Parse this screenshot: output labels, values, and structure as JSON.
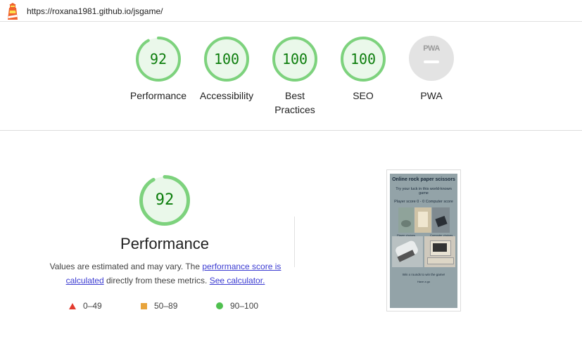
{
  "header": {
    "url": "https://roxana1981.github.io/jsgame/"
  },
  "categories": [
    {
      "score": "92",
      "label": "Performance",
      "fraction": 0.92
    },
    {
      "score": "100",
      "label": "Accessibility",
      "fraction": 1.0
    },
    {
      "score": "100",
      "label": "Best Practices",
      "fraction": 1.0
    },
    {
      "score": "100",
      "label": "SEO",
      "fraction": 1.0
    }
  ],
  "pwa": {
    "badge_text": "PWA",
    "label": "PWA"
  },
  "performance": {
    "score": "92",
    "fraction": 0.92,
    "title": "Performance",
    "desc_prefix": "Values are estimated and may vary. The ",
    "link_score": "performance score is calculated",
    "desc_middle": " directly from these metrics. ",
    "link_calc": "See calculator."
  },
  "legend": [
    {
      "range": "0–49",
      "color": "#e33b2e"
    },
    {
      "range": "50–89",
      "color": "#e8a43c"
    },
    {
      "range": "90–100",
      "color": "#4fc04f"
    }
  ],
  "colors": {
    "pass_ring": "#7dd27d",
    "pass_fill": "#eaf8ea",
    "pass_text": "#0c7d0c"
  },
  "screenshot": {
    "title": "Online rock paper scissors",
    "subtitle": "Try your luck in this world-known game",
    "score_line": "Player score 0 - 0 Computer score",
    "caption_left": "Player choices",
    "caption_right": "Computer choices",
    "footer_line": "Win x rounds to win the game!",
    "footer_small": "Have a go"
  }
}
